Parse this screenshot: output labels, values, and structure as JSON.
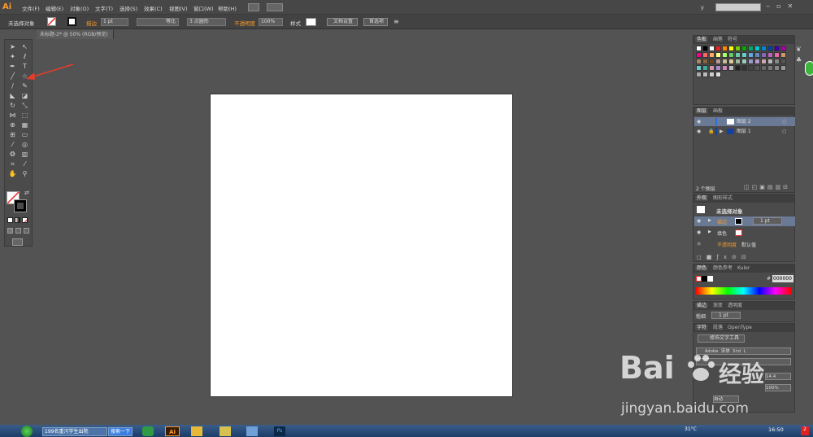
{
  "app": {
    "logo": "Ai"
  },
  "menubar": {
    "items": [
      "文件(F)",
      "编辑(E)",
      "对象(O)",
      "文字(T)",
      "选择(S)",
      "效果(C)",
      "视图(V)",
      "窗口(W)",
      "帮助(H)"
    ],
    "workspace_label": "y",
    "search_placeholder": ""
  },
  "controlbar": {
    "selection_label": "未选择对象",
    "stroke_label": "描边",
    "stroke_weight": "1 pt",
    "stroke_style": "等比",
    "brush": "3 点圆形",
    "opacity_label": "不透明度",
    "opacity_value": "100%",
    "style_label": "样式",
    "doc_setup": "文档设置",
    "preferences": "首选项"
  },
  "document": {
    "tab_title": "未标题-2* @ 50% (RGB/预览)"
  },
  "panels": {
    "swatches": {
      "tabs": [
        "色板",
        "画笔",
        "符号"
      ]
    },
    "layers": {
      "tabs": [
        "图层",
        "画板"
      ],
      "rows": [
        {
          "name": "图层 2",
          "color": "#2a6de0"
        },
        {
          "name": "图层 1",
          "color": "#1440a0"
        }
      ],
      "count": "2 个图层"
    },
    "appearance": {
      "tabs": [
        "外观",
        "图形样式"
      ],
      "title": "未选择对象",
      "stroke_label": "描边",
      "stroke_value": "1 pt",
      "fill_label": "填色",
      "opacity_label": "不透明度",
      "opacity_value": "默认值"
    },
    "color": {
      "tabs": [
        "颜色",
        "颜色参考",
        "Kuler"
      ],
      "hex_label": "#",
      "hex_value": "000000"
    },
    "stroke": {
      "tabs": [
        "描边",
        "渐变",
        "透明度"
      ],
      "weight_label": "粗细",
      "weight_value": "1 pt"
    },
    "character": {
      "tabs": [
        "字符",
        "段落",
        "OpenType"
      ],
      "touch_tool": "修饰文字工具",
      "font": "Adobe 宋体 Std L",
      "size": "14.4",
      "tracking": "100%",
      "auto": "自动"
    }
  },
  "taskbar": {
    "task1": "199名重污学生出院",
    "task2": "搜索一下",
    "time": "16:50",
    "temp": "31°C"
  },
  "watermark": {
    "text": "Bai",
    "text2": "经验",
    "url": "jingyan.baidu.com"
  },
  "colors": {
    "accent": "#f79a2a",
    "arrow": "#e53b2c"
  }
}
